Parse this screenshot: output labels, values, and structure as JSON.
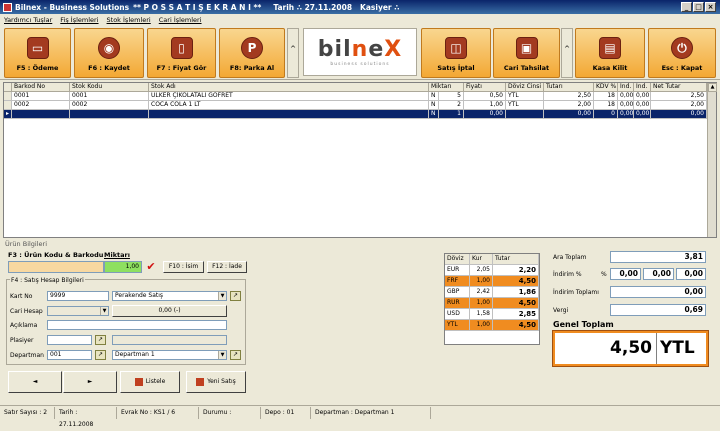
{
  "window": {
    "app_name": "Bilnex - Business Solutions",
    "screen_title": "** P O S   S A T I Ş   E K R A N I **",
    "date_label": "Tarih ∴ 27.11.2008",
    "cashier_label": "Kasiyer ∴",
    "min": "_",
    "max": "□",
    "close": "×"
  },
  "menu": [
    "Yardımcı Tuşlar",
    "Fiş İşlemleri",
    "Stok İşlemleri",
    "Cari İşlemleri"
  ],
  "toolbar": {
    "pay": "F5 : Ödeme",
    "save": "F6 : Kaydet",
    "price": "F7 : Fiyat Gör",
    "park": "F8: Parka Al",
    "cancel_sale": "Satış İptal",
    "cari": "Cari Tahsilat",
    "lock": "Kasa Kilit",
    "exit": "Esc : Kapat",
    "chevron": "^"
  },
  "logo": {
    "left": "bil",
    "accent": "n",
    "mid": "e",
    "accent2": "X",
    "sub": "business  solutions"
  },
  "grid": {
    "headers": [
      "Barkod No",
      "Stok Kodu",
      "Stok Adı",
      "Miktarı",
      "Fiyatı",
      "Döviz Cinsi",
      "Tutarı",
      "KDV %",
      "İnd.",
      "İnd.",
      "Net Tutar"
    ],
    "rows": [
      [
        "0001",
        "0001",
        "ÜLKER ÇİKOLATALI GOFRET",
        "N",
        "5",
        "0,50",
        "YTL",
        "2,50",
        "18",
        "0,00",
        "0,00",
        "2,50"
      ],
      [
        "0002",
        "0002",
        "COCA COLA 1 LT",
        "N",
        "2",
        "1,00",
        "YTL",
        "2,00",
        "18",
        "0,00",
        "0,00",
        "2,00"
      ],
      [
        "",
        "",
        "",
        "N",
        "1",
        "0,00",
        "",
        "0,00",
        "0",
        "0,00",
        "0,00",
        "0,00"
      ]
    ]
  },
  "product": {
    "section": "Ürün Bilgileri",
    "f3_label": "F3 : Ürün Kodu & Barkodu",
    "qty_label": "Miktarı",
    "qty_value": "1,00",
    "f10": "F10 : İsim",
    "f12": "F12 : İade",
    "account_section": "F4 : Satış Hesap Bilgileri",
    "kart_no": "Kart No",
    "kart_no_value": "9999",
    "sale_type": "Perakende Satış",
    "cari_hesap": "Cari Hesap",
    "cari_amount": "0,00 (-)",
    "aciklama": "Açıklama",
    "plasiyer": "Plasiyer",
    "departman": "Departman",
    "dept_code": "001",
    "dept_name": "Departman 1",
    "prev": "◄",
    "next": "►",
    "list": "Listele",
    "new_sale": "Yeni Satış"
  },
  "currency": {
    "headers": [
      "Döviz",
      "Kur",
      "Tutar"
    ],
    "rows": [
      [
        "EUR",
        "2,05",
        "2,20",
        false
      ],
      [
        "FRF",
        "1,00",
        "4,50",
        true
      ],
      [
        "GBP",
        "2,42",
        "1,86",
        false
      ],
      [
        "RUR",
        "1,00",
        "4,50",
        true
      ],
      [
        "USD",
        "1,58",
        "2,85",
        false
      ],
      [
        "YTL",
        "1,00",
        "4,50",
        true
      ]
    ]
  },
  "totals": {
    "ara_toplam": "Ara Toplam",
    "ara_value": "3,81",
    "indirim": "İndirim %",
    "pct": "%",
    "ind1": "0,00",
    "ind2": "0,00",
    "ind3": "0,00",
    "indirim_toplami": "İndirim Toplamı",
    "indirim_value": "0,00",
    "vergi": "Vergi",
    "vergi_value": "0,69",
    "genel": "Genel Toplam",
    "genel_value": "4,50",
    "genel_cur": "YTL"
  },
  "status": [
    "Satır Sayısı : 2",
    "Tarih : 27.11.2008",
    "Evrak No : KS1 / 6",
    "Durumu :",
    "Depo : 01",
    "Departman : Departman 1"
  ]
}
